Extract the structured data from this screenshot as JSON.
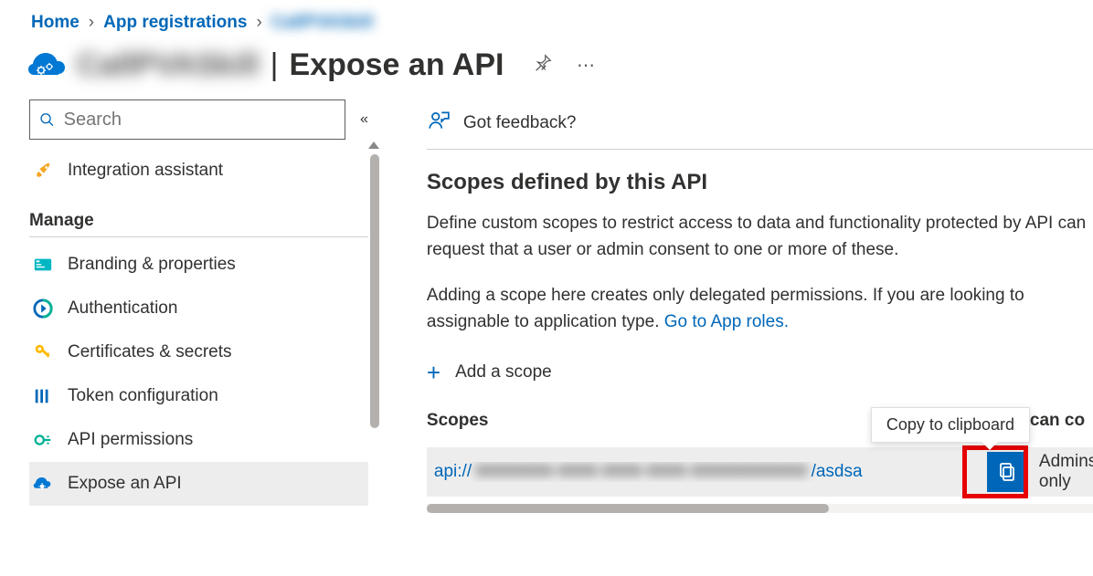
{
  "breadcrumb": {
    "home": "Home",
    "app_regs": "App registrations",
    "current": "CallPVASkill"
  },
  "header": {
    "app_name": "CallPVASkill",
    "page_title": "Expose an API"
  },
  "sidebar": {
    "search_placeholder": "Search",
    "integration_assistant": "Integration assistant",
    "manage_heading": "Manage",
    "items": {
      "branding": "Branding & properties",
      "authentication": "Authentication",
      "certificates": "Certificates & secrets",
      "token_config": "Token configuration",
      "api_permissions": "API permissions",
      "expose_api": "Expose an API"
    }
  },
  "content": {
    "feedback": "Got feedback?",
    "section_title": "Scopes defined by this API",
    "para1": "Define custom scopes to restrict access to data and functionality protected by API can request that a user or admin consent to one or more of these.",
    "para2a": "Adding a scope here creates only delegated permissions. If you are looking to assignable to application type. ",
    "para2_link": "Go to App roles.",
    "add_scope": "Add a scope",
    "col_scopes": "Scopes",
    "col_who": "can co",
    "scope_row": {
      "prefix": "api://",
      "guid": "00000000-0000-0000-0000-000000000000",
      "suffix": "/asdsa",
      "consent": "Admins only"
    },
    "copy_tooltip": "Copy to clipboard"
  }
}
